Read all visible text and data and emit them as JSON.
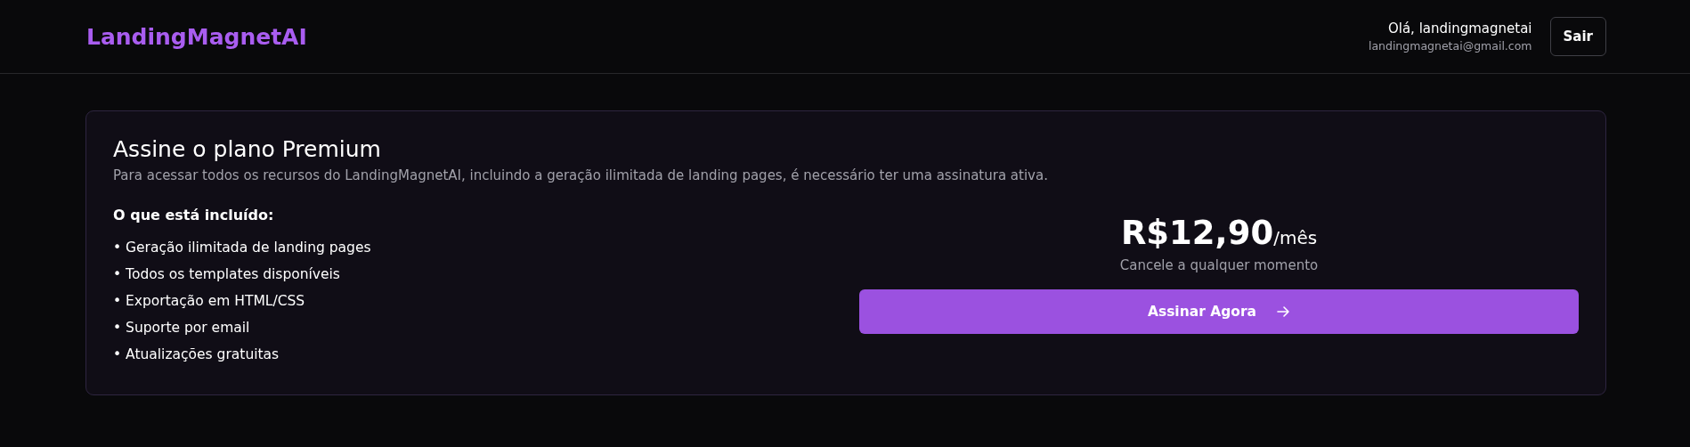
{
  "header": {
    "logo": "LandingMagnetAI",
    "greeting": "Olá, landingmagnetai",
    "email": "landingmagnetai@gmail.com",
    "logout_button": "Sair"
  },
  "card": {
    "title": "Assine o plano Premium",
    "description": "Para acessar todos os recursos do LandingMagnetAI, incluindo a geração ilimitada de landing pages, é necessário ter uma assinatura ativa.",
    "features_heading": "O que está incluído:",
    "features": [
      "• Geração ilimitada de landing pages",
      "• Todos os templates disponíveis",
      "• Exportação em HTML/CSS",
      "• Suporte por email",
      "• Atualizações gratuitas"
    ],
    "price": "R$12,90",
    "period": "/mês",
    "note": "Cancele a qualquer momento",
    "cta_button": "Assinar Agora"
  }
}
